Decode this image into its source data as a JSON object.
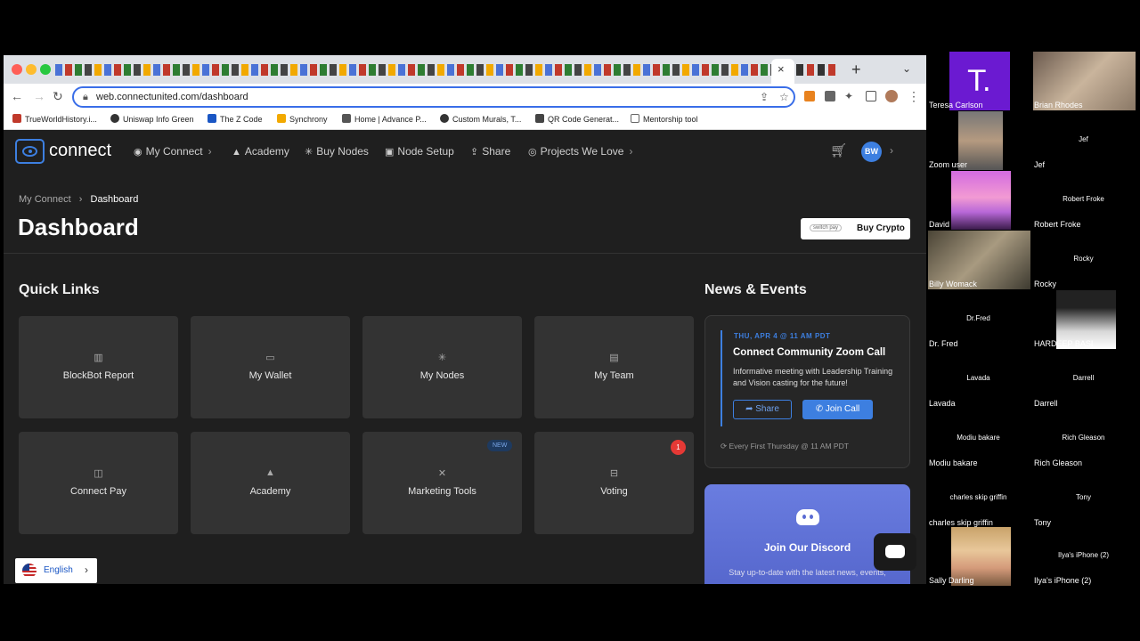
{
  "browser": {
    "url": "web.connectunited.com/dashboard",
    "bookmarks": [
      "TrueWorldHistory.i...",
      "Uniswap Info Green",
      "The Z Code",
      "Synchrony",
      "Home | Advance P...",
      "Custom Murals, T...",
      "QR Code Generat...",
      "Mentorship tool"
    ]
  },
  "app": {
    "logo_text": "connect",
    "nav": {
      "my_connect": "My Connect",
      "academy": "Academy",
      "buy_nodes": "Buy Nodes",
      "node_setup": "Node Setup",
      "share": "Share",
      "projects": "Projects We Love"
    },
    "avatar_initials": "BW",
    "breadcrumb": {
      "parent": "My Connect",
      "current": "Dashboard"
    },
    "page_title": "Dashboard",
    "buy_crypto": {
      "brand": "switch pay",
      "label": "Buy Crypto"
    },
    "quick_links_title": "Quick Links",
    "quick_links": {
      "blockbot": "BlockBot Report",
      "wallet": "My Wallet",
      "nodes": "My Nodes",
      "team": "My Team",
      "connect_pay": "Connect Pay",
      "academy": "Academy",
      "marketing": "Marketing Tools",
      "voting": "Voting",
      "new_badge": "NEW",
      "voting_count": "1"
    },
    "news_title": "News & Events",
    "event": {
      "date": "THU, APR 4 @ 11 AM PDT",
      "title": "Connect Community Zoom Call",
      "description": "Informative meeting with Leadership Training and Vision casting for the future!",
      "share": "Share",
      "join": "Join Call",
      "recurrence": "Every First Thursday @ 11 AM PDT"
    },
    "discord": {
      "title": "Join Our Discord",
      "description": "Stay up-to-date with the latest news, events,"
    },
    "language": "English"
  },
  "zoom": {
    "participants": {
      "teresa": "Teresa Carlson",
      "teresa_initial": "T.",
      "brian": "Brian Rhodes",
      "zoom_user": "Zoom user",
      "jef": "Jef",
      "david": "David",
      "robert": "Robert Froke",
      "billy": "Billy Womack",
      "rocky": "Rocky",
      "fred": "Dr. Fred",
      "fred_center": "Dr.Fred",
      "hardeep": "HARDEEP BASI",
      "lavada": "Lavada",
      "darrell": "Darrell",
      "modiu": "Modiu bakare",
      "rich": "Rich Gleason",
      "charles": "charles skip griffin",
      "tony": "Tony",
      "sally": "Sally Darling",
      "ilya": "Ilya's iPhone (2)"
    }
  },
  "colors": {
    "accent": "#3d7fe0",
    "background": "#1f1f1f",
    "card": "#333333",
    "discord": "#5865f2",
    "zoom_letter": "#6b1ad1"
  }
}
